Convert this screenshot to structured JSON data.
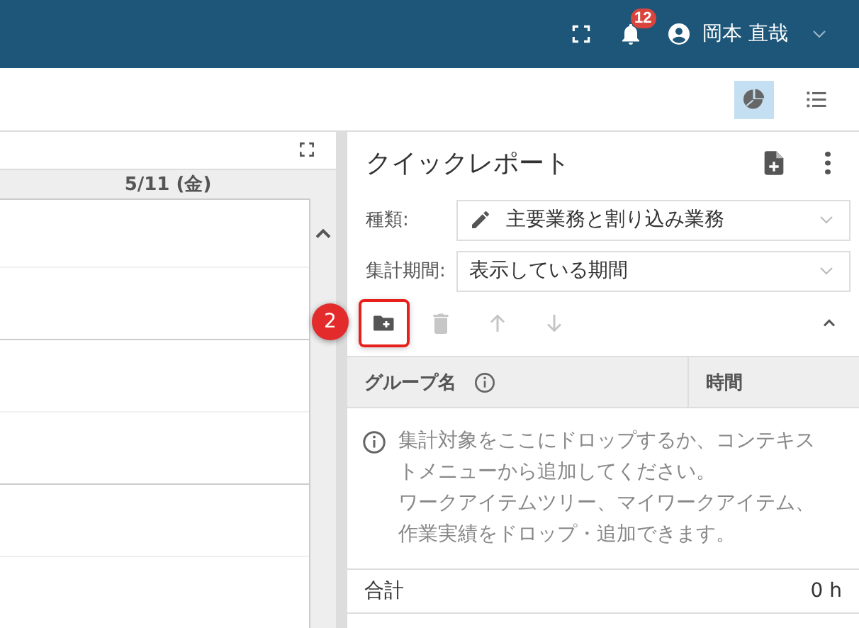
{
  "header": {
    "notification_count": "12",
    "user_name": "岡本 直哉"
  },
  "view_toggle": [
    {
      "kind": "chart",
      "selected": true
    },
    {
      "kind": "list",
      "selected": false
    }
  ],
  "calendar": {
    "day_header": "5/11 (金)"
  },
  "quick_report": {
    "title": "クイックレポート",
    "fields": [
      {
        "label": "種類:",
        "value": "主要業務と割り込み業務",
        "kind": "edit"
      },
      {
        "label": "集計期間:",
        "value": "表示している期間",
        "kind": "plain"
      }
    ],
    "tools": [
      {
        "kind": "add-folder",
        "disabled": false,
        "highlighted": true,
        "step_badge": "2"
      },
      {
        "kind": "delete",
        "disabled": true,
        "highlighted": false
      },
      {
        "kind": "up",
        "disabled": true,
        "highlighted": false
      },
      {
        "kind": "down",
        "disabled": true,
        "highlighted": false
      }
    ],
    "columns": [
      "グループ名",
      "時間"
    ],
    "empty_message": [
      "集計対象をここにドロップするか、コンテキストメニューから追加してください。",
      "ワークアイテムツリー、マイワークアイテム、作業実績をドロップ・追加できます。"
    ],
    "total_label": "合計",
    "total_value": "0 h"
  }
}
